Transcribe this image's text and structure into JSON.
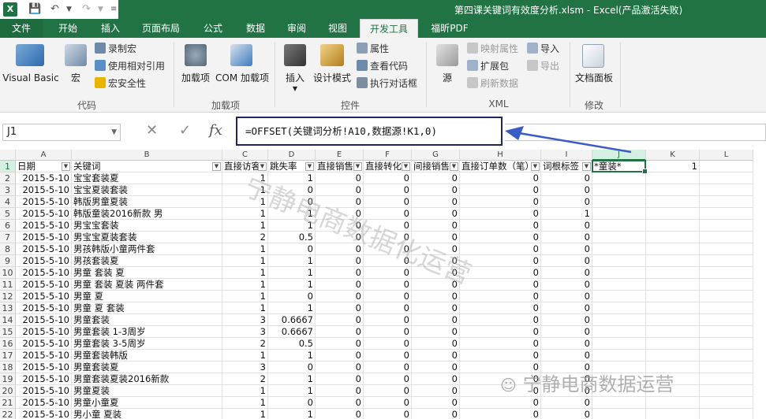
{
  "app": {
    "title": "第四课关键词有效度分析.xlsm - Excel(产品激活失败)",
    "logo": "X"
  },
  "tabs": [
    "文件",
    "开始",
    "插入",
    "页面布局",
    "公式",
    "数据",
    "审阅",
    "视图",
    "开发工具",
    "福昕PDF"
  ],
  "ribbon": {
    "code": {
      "vb": "Visual Basic",
      "macro": "宏",
      "record": "录制宏",
      "relative": "使用相对引用",
      "security": "宏安全性",
      "group": "代码"
    },
    "addins": {
      "addins": "加载项",
      "com": "COM 加载项",
      "group": "加载项"
    },
    "controls": {
      "insert": "插入",
      "design": "设计模式",
      "props": "属性",
      "viewcode": "查看代码",
      "dialog": "执行对话框",
      "group": "控件"
    },
    "xml": {
      "source": "源",
      "map": "映射属性",
      "pack": "扩展包",
      "refresh": "刷新数据",
      "import": "导入",
      "export": "导出",
      "group": "XML"
    },
    "modify": {
      "panel": "文档面板",
      "group": "修改"
    }
  },
  "formula_bar": {
    "name_box": "J1",
    "formula": "=OFFSET(关键词分析!A10,数据源!K1,0)"
  },
  "columns": [
    "A",
    "B",
    "C",
    "D",
    "E",
    "F",
    "G",
    "H",
    "I",
    "J",
    "K",
    "L"
  ],
  "header_row": [
    "日期",
    "关键词",
    "直接访客",
    "跳失率",
    "直接销售",
    "直接转化",
    "间接销售",
    "直接订单数（笔）",
    "词根标签",
    "*童装*",
    "1",
    ""
  ],
  "rows": [
    [
      "2015-5-10",
      "宝宝套装夏",
      "1",
      "1",
      "0",
      "0",
      "0",
      "0",
      "0"
    ],
    [
      "2015-5-10",
      "宝宝夏装套装",
      "1",
      "0",
      "0",
      "0",
      "0",
      "0",
      "0"
    ],
    [
      "2015-5-10",
      "韩版男童夏装",
      "1",
      "0",
      "0",
      "0",
      "0",
      "0",
      "0"
    ],
    [
      "2015-5-10",
      "韩版童装2016新款 男",
      "1",
      "1",
      "0",
      "0",
      "0",
      "0",
      "1"
    ],
    [
      "2015-5-10",
      "男宝宝套装",
      "1",
      "1",
      "0",
      "0",
      "0",
      "0",
      "0"
    ],
    [
      "2015-5-10",
      "男宝宝夏装套装",
      "2",
      "0.5",
      "0",
      "0",
      "0",
      "0",
      "0"
    ],
    [
      "2015-5-10",
      "男孩韩版小童两件套",
      "1",
      "0",
      "0",
      "0",
      "0",
      "0",
      "0"
    ],
    [
      "2015-5-10",
      "男孩套装夏",
      "1",
      "1",
      "0",
      "0",
      "0",
      "0",
      "0"
    ],
    [
      "2015-5-10",
      "男童 套装 夏",
      "1",
      "1",
      "0",
      "0",
      "0",
      "0",
      "0"
    ],
    [
      "2015-5-10",
      "男童 套装 夏装 两件套",
      "1",
      "1",
      "0",
      "0",
      "0",
      "0",
      "0"
    ],
    [
      "2015-5-10",
      "男童 夏",
      "1",
      "0",
      "0",
      "0",
      "0",
      "0",
      "0"
    ],
    [
      "2015-5-10",
      "男童 夏 套装",
      "1",
      "1",
      "0",
      "0",
      "0",
      "0",
      "0"
    ],
    [
      "2015-5-10",
      "男童套装",
      "3",
      "0.6667",
      "0",
      "0",
      "0",
      "0",
      "0"
    ],
    [
      "2015-5-10",
      "男童套装 1-3周岁",
      "3",
      "0.6667",
      "0",
      "0",
      "0",
      "0",
      "0"
    ],
    [
      "2015-5-10",
      "男童套装 3-5周岁",
      "2",
      "0.5",
      "0",
      "0",
      "0",
      "0",
      "0"
    ],
    [
      "2015-5-10",
      "男童套装韩版",
      "1",
      "1",
      "0",
      "0",
      "0",
      "0",
      "0"
    ],
    [
      "2015-5-10",
      "男童套装夏",
      "3",
      "0",
      "0",
      "0",
      "0",
      "0",
      "0"
    ],
    [
      "2015-5-10",
      "男童套装夏装2016新款",
      "2",
      "1",
      "0",
      "0",
      "0",
      "0",
      "0"
    ],
    [
      "2015-5-10",
      "男童夏装",
      "1",
      "1",
      "0",
      "0",
      "0",
      "0",
      "0"
    ],
    [
      "2015-5-10",
      "男童小童夏",
      "1",
      "0",
      "0",
      "0",
      "0",
      "0",
      "0"
    ],
    [
      "2015-5-10",
      "男小童 夏装",
      "1",
      "1",
      "0",
      "0",
      "0",
      "0",
      "0"
    ]
  ],
  "watermark": {
    "diagonal": "宁静电商数据化运营",
    "bottom": "宁静电商数据运营"
  }
}
